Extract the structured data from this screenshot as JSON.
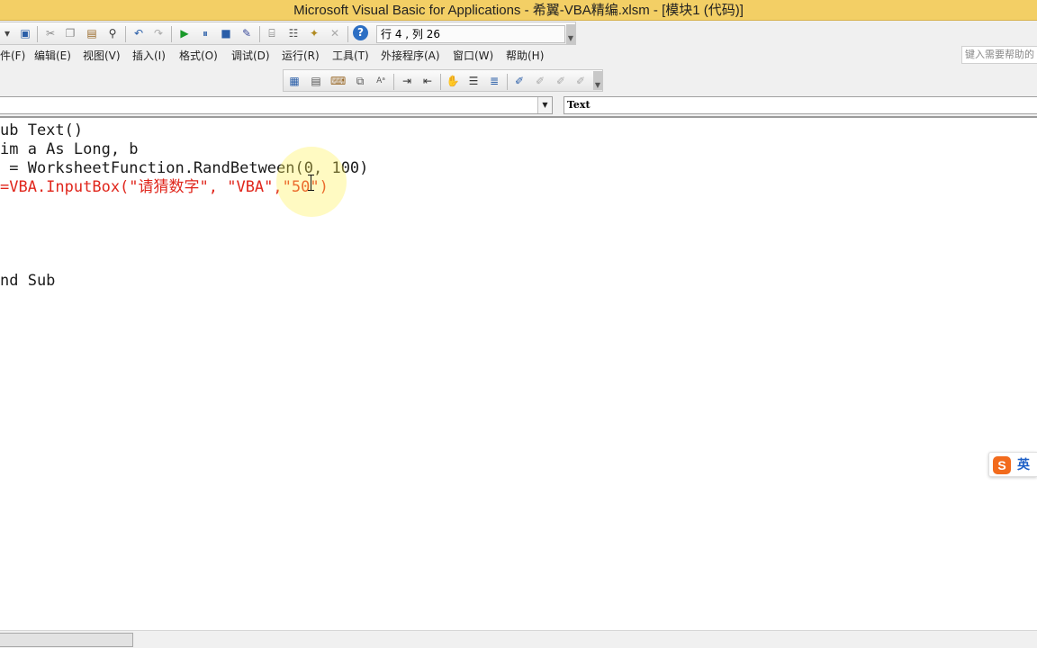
{
  "window": {
    "title": "Microsoft Visual Basic for Applications - 希翼-VBA精编.xlsm - [模块1 (代码)]"
  },
  "toolbar": {
    "cursor_position": "行 4 , 列 26",
    "icons": [
      "view-excel-icon",
      "save-icon",
      "cut-icon",
      "copy-icon",
      "paste-icon",
      "find-icon",
      "undo-icon",
      "redo-icon",
      "run-icon",
      "break-icon",
      "reset-icon",
      "design-mode-icon",
      "project-explorer-icon",
      "properties-icon",
      "object-browser-icon",
      "toolbox-icon",
      "help-icon"
    ]
  },
  "menu": {
    "items": [
      "件(F)",
      "编辑(E)",
      "视图(V)",
      "插入(I)",
      "格式(O)",
      "调试(D)",
      "运行(R)",
      "工具(T)",
      "外接程序(A)",
      "窗口(W)",
      "帮助(H)"
    ]
  },
  "help_search": {
    "placeholder": "键入需要帮助的"
  },
  "edit_toolbar": {
    "icons": [
      "list-properties-icon",
      "list-constants-icon",
      "quick-info-icon",
      "parameter-info-icon",
      "complete-word-icon",
      "indent-icon",
      "outdent-icon",
      "toggle-breakpoint-icon",
      "comment-block-icon",
      "uncomment-block-icon",
      "toggle-bookmark-icon",
      "next-bookmark-icon",
      "previous-bookmark-icon",
      "clear-bookmarks-icon"
    ]
  },
  "code_pane": {
    "object_combo": "",
    "procedure_combo": "Text",
    "lines": [
      {
        "text": "ub Text()",
        "color": "#1a1a1a"
      },
      {
        "text": "im a As Long, b",
        "color": "#1a1a1a"
      },
      {
        "text": " = WorksheetFunction.RandBetween(0, 100)",
        "color": "#1a1a1a"
      },
      {
        "text": "=VBA.InputBox(\"请猜数字\", \"VBA\",\"50\")",
        "color": "#e0261c"
      },
      {
        "text": "",
        "color": "#1a1a1a"
      },
      {
        "text": "",
        "color": "#1a1a1a"
      },
      {
        "text": "",
        "color": "#1a1a1a"
      },
      {
        "text": "nd Sub",
        "color": "#1a1a1a"
      }
    ]
  },
  "ime": {
    "logo": "S",
    "mode": "英"
  }
}
